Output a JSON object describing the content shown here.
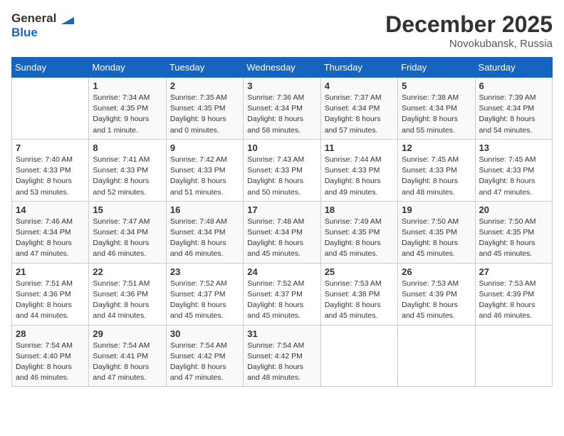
{
  "logo": {
    "line1": "General",
    "line2": "Blue"
  },
  "title": "December 2025",
  "location": "Novokubansk, Russia",
  "weekdays": [
    "Sunday",
    "Monday",
    "Tuesday",
    "Wednesday",
    "Thursday",
    "Friday",
    "Saturday"
  ],
  "weeks": [
    [
      {
        "day": "",
        "info": ""
      },
      {
        "day": "1",
        "info": "Sunrise: 7:34 AM\nSunset: 4:35 PM\nDaylight: 9 hours\nand 1 minute."
      },
      {
        "day": "2",
        "info": "Sunrise: 7:35 AM\nSunset: 4:35 PM\nDaylight: 9 hours\nand 0 minutes."
      },
      {
        "day": "3",
        "info": "Sunrise: 7:36 AM\nSunset: 4:34 PM\nDaylight: 8 hours\nand 58 minutes."
      },
      {
        "day": "4",
        "info": "Sunrise: 7:37 AM\nSunset: 4:34 PM\nDaylight: 8 hours\nand 57 minutes."
      },
      {
        "day": "5",
        "info": "Sunrise: 7:38 AM\nSunset: 4:34 PM\nDaylight: 8 hours\nand 55 minutes."
      },
      {
        "day": "6",
        "info": "Sunrise: 7:39 AM\nSunset: 4:34 PM\nDaylight: 8 hours\nand 54 minutes."
      }
    ],
    [
      {
        "day": "7",
        "info": "Sunrise: 7:40 AM\nSunset: 4:33 PM\nDaylight: 8 hours\nand 53 minutes."
      },
      {
        "day": "8",
        "info": "Sunrise: 7:41 AM\nSunset: 4:33 PM\nDaylight: 8 hours\nand 52 minutes."
      },
      {
        "day": "9",
        "info": "Sunrise: 7:42 AM\nSunset: 4:33 PM\nDaylight: 8 hours\nand 51 minutes."
      },
      {
        "day": "10",
        "info": "Sunrise: 7:43 AM\nSunset: 4:33 PM\nDaylight: 8 hours\nand 50 minutes."
      },
      {
        "day": "11",
        "info": "Sunrise: 7:44 AM\nSunset: 4:33 PM\nDaylight: 8 hours\nand 49 minutes."
      },
      {
        "day": "12",
        "info": "Sunrise: 7:45 AM\nSunset: 4:33 PM\nDaylight: 8 hours\nand 48 minutes."
      },
      {
        "day": "13",
        "info": "Sunrise: 7:45 AM\nSunset: 4:33 PM\nDaylight: 8 hours\nand 47 minutes."
      }
    ],
    [
      {
        "day": "14",
        "info": "Sunrise: 7:46 AM\nSunset: 4:34 PM\nDaylight: 8 hours\nand 47 minutes."
      },
      {
        "day": "15",
        "info": "Sunrise: 7:47 AM\nSunset: 4:34 PM\nDaylight: 8 hours\nand 46 minutes."
      },
      {
        "day": "16",
        "info": "Sunrise: 7:48 AM\nSunset: 4:34 PM\nDaylight: 8 hours\nand 46 minutes."
      },
      {
        "day": "17",
        "info": "Sunrise: 7:48 AM\nSunset: 4:34 PM\nDaylight: 8 hours\nand 45 minutes."
      },
      {
        "day": "18",
        "info": "Sunrise: 7:49 AM\nSunset: 4:35 PM\nDaylight: 8 hours\nand 45 minutes."
      },
      {
        "day": "19",
        "info": "Sunrise: 7:50 AM\nSunset: 4:35 PM\nDaylight: 8 hours\nand 45 minutes."
      },
      {
        "day": "20",
        "info": "Sunrise: 7:50 AM\nSunset: 4:35 PM\nDaylight: 8 hours\nand 45 minutes."
      }
    ],
    [
      {
        "day": "21",
        "info": "Sunrise: 7:51 AM\nSunset: 4:36 PM\nDaylight: 8 hours\nand 44 minutes."
      },
      {
        "day": "22",
        "info": "Sunrise: 7:51 AM\nSunset: 4:36 PM\nDaylight: 8 hours\nand 44 minutes."
      },
      {
        "day": "23",
        "info": "Sunrise: 7:52 AM\nSunset: 4:37 PM\nDaylight: 8 hours\nand 45 minutes."
      },
      {
        "day": "24",
        "info": "Sunrise: 7:52 AM\nSunset: 4:37 PM\nDaylight: 8 hours\nand 45 minutes."
      },
      {
        "day": "25",
        "info": "Sunrise: 7:53 AM\nSunset: 4:38 PM\nDaylight: 8 hours\nand 45 minutes."
      },
      {
        "day": "26",
        "info": "Sunrise: 7:53 AM\nSunset: 4:39 PM\nDaylight: 8 hours\nand 45 minutes."
      },
      {
        "day": "27",
        "info": "Sunrise: 7:53 AM\nSunset: 4:39 PM\nDaylight: 8 hours\nand 46 minutes."
      }
    ],
    [
      {
        "day": "28",
        "info": "Sunrise: 7:54 AM\nSunset: 4:40 PM\nDaylight: 8 hours\nand 46 minutes."
      },
      {
        "day": "29",
        "info": "Sunrise: 7:54 AM\nSunset: 4:41 PM\nDaylight: 8 hours\nand 47 minutes."
      },
      {
        "day": "30",
        "info": "Sunrise: 7:54 AM\nSunset: 4:42 PM\nDaylight: 8 hours\nand 47 minutes."
      },
      {
        "day": "31",
        "info": "Sunrise: 7:54 AM\nSunset: 4:42 PM\nDaylight: 8 hours\nand 48 minutes."
      },
      {
        "day": "",
        "info": ""
      },
      {
        "day": "",
        "info": ""
      },
      {
        "day": "",
        "info": ""
      }
    ]
  ]
}
